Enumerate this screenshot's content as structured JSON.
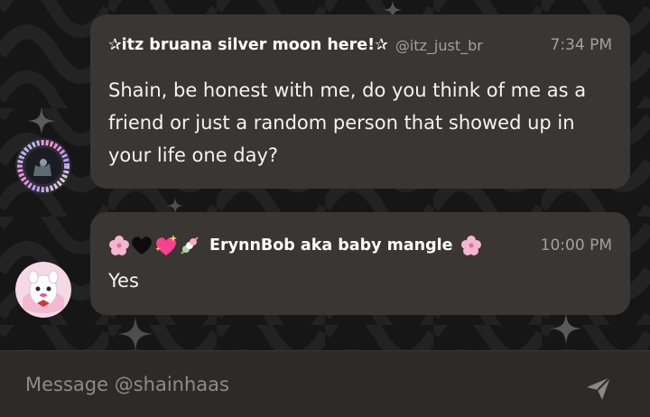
{
  "messages": [
    {
      "sender": "✰itz bruana silver moon here!✰",
      "handle": "@itz_just_br",
      "time": "7:34 PM",
      "text": "Shain, be honest with me, do you think of me as a friend or just a random person that showed up in your life one day?"
    },
    {
      "sender": "ErynnBob aka baby mangle",
      "time": "10:00 PM",
      "text": "Yes"
    }
  ],
  "composer": {
    "placeholder": "Message @shainhaas"
  },
  "colors": {
    "background": "#161616",
    "bubble": "#393633",
    "muted_text": "#a4a09b"
  },
  "icons": [
    "sparkle-icon",
    "cherry-blossom-icon",
    "black-heart-icon",
    "sparkling-heart-icon",
    "dango-icon",
    "send-icon"
  ]
}
